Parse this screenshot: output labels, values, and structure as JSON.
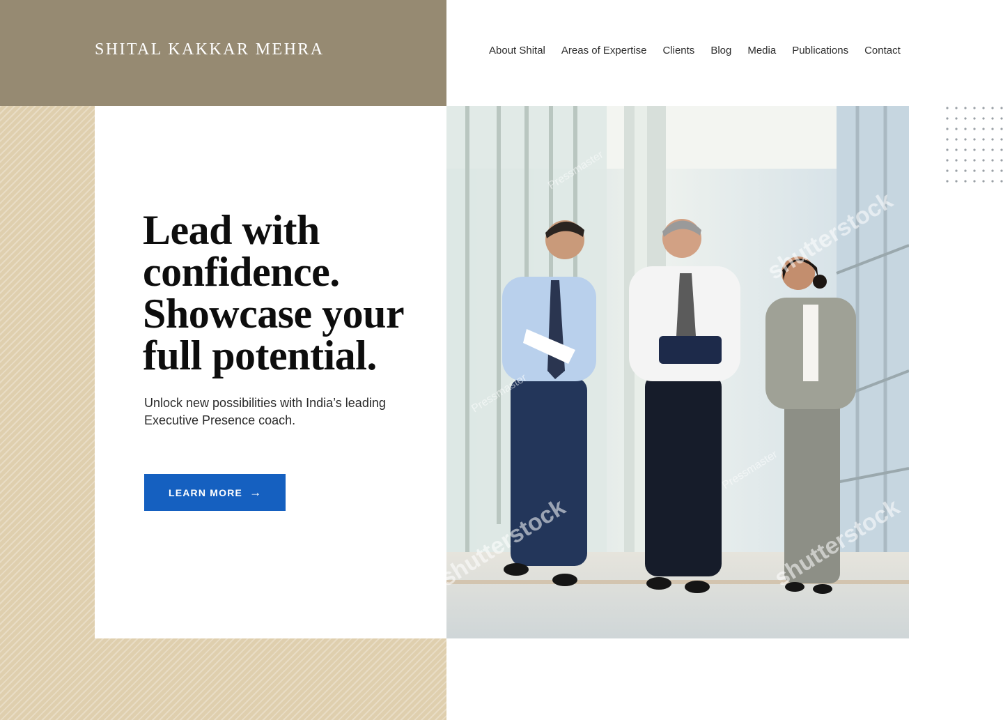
{
  "brand": {
    "name": "SHITAL KAKKAR MEHRA"
  },
  "nav": {
    "items": [
      "About Shital",
      "Areas of Expertise",
      "Clients",
      "Blog",
      "Media",
      "Publications",
      "Contact"
    ]
  },
  "hero": {
    "headline_lines": [
      "Lead with",
      "confidence.",
      "Showcase your",
      "full potential."
    ],
    "subtext": "Unlock new possibilities with India’s leading Executive Presence coach.",
    "cta_label": "LEARN MORE",
    "cta_icon": "arrow-right-icon",
    "photo_watermarks": [
      "shutterstock",
      "Pressmaster"
    ]
  },
  "colors": {
    "brand_band": "#968a72",
    "stripe_band": "#dfcfae",
    "cta": "#1560c0",
    "text_dark": "#0d0d0d"
  }
}
